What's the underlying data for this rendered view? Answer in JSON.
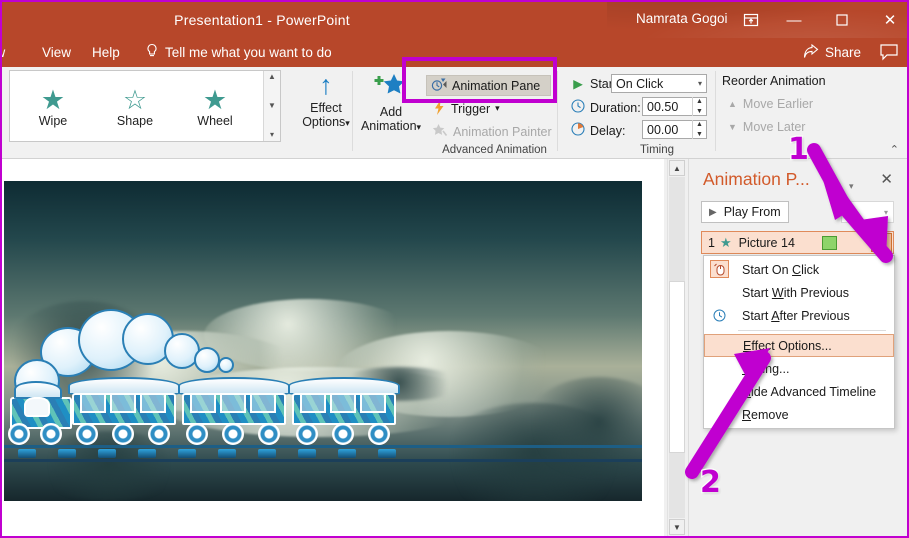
{
  "titlebar": {
    "document_title": "Presentation1  -  PowerPoint",
    "user_name": "Namrata Gogoi",
    "ribbon_display_icon": "ribbon-display-options-icon",
    "minimize": "—",
    "maximize": "☐",
    "close": "✕"
  },
  "tabs": {
    "review": "ew",
    "view": "View",
    "help": "Help",
    "tellme": "Tell me what you want to do",
    "tellme_icon": "lightbulb-icon",
    "share": "Share",
    "share_icon": "share-icon",
    "comment_icon": "comment-icon"
  },
  "ribbon": {
    "gallery": {
      "items": [
        {
          "label": "Wipe",
          "icon": "star-icon"
        },
        {
          "label": "Shape",
          "icon": "star-hollow-icon"
        },
        {
          "label": "Wheel",
          "icon": "star-icon"
        }
      ],
      "scroll_up": "▲",
      "scroll_down": "▼",
      "scroll_more": "▾"
    },
    "effect_options": {
      "label_line1": "Effect",
      "label_line2": "Options",
      "icon": "up-arrow-icon",
      "dropdown": "▾"
    },
    "dialog_launcher": "⤷",
    "add_animation": {
      "label_line1": "Add",
      "label_line2": "Animation",
      "icon": "add-animation-star-icon",
      "dropdown": "▾"
    },
    "advanced_animation": {
      "group_label": "Advanced Animation",
      "animation_pane": {
        "label": "Animation Pane",
        "icon": "animation-pane-icon",
        "active": true
      },
      "trigger": {
        "label": "Trigger",
        "icon": "trigger-bolt-icon",
        "dropdown": "▾"
      },
      "animation_painter": {
        "label": "Animation Painter",
        "icon": "animation-painter-icon",
        "disabled": true
      }
    },
    "timing": {
      "group_label": "Timing",
      "start_label": "Start:",
      "start_value": "On Click",
      "start_icon": "play-icon",
      "duration_label": "Duration:",
      "duration_value": "00.50",
      "duration_icon": "clock-icon",
      "delay_label": "Delay:",
      "delay_value": "00.00",
      "delay_icon": "delay-clock-icon",
      "spinner_up": "▲",
      "spinner_down": "▼",
      "combo_arrow": "▾"
    },
    "reorder": {
      "title": "Reorder Animation",
      "move_earlier": "Move Earlier",
      "move_later": "Move Later",
      "up_icon": "▲",
      "down_icon": "▼"
    },
    "collapse_icon": "⌃"
  },
  "slide": {
    "scroll_up": "▲",
    "scroll_down": "▼",
    "content_description": "cartoon blue train with three carriages and bubble smoke over a cloudy sky"
  },
  "animation_pane": {
    "title": "Animation P...",
    "menu_icon": "▾",
    "close_icon": "✕",
    "play_from": "Play From",
    "play_icon": "▶",
    "seek_arrow": "▾",
    "item": {
      "index": "1",
      "star_icon": "★",
      "name": "Picture 14",
      "timing_bar": "green-timing-bar",
      "dropdown_arrow": "▾"
    },
    "context_menu": [
      {
        "label_pre": "Start On ",
        "accel": "C",
        "label_post": "lick",
        "icon": "mouse-click-icon",
        "selected": false
      },
      {
        "label_pre": "Start ",
        "accel": "W",
        "label_post": "ith Previous",
        "icon": "",
        "selected": false
      },
      {
        "label_pre": "Start ",
        "accel": "A",
        "label_post": "fter Previous",
        "icon": "clock-icon",
        "selected": false
      },
      {
        "label_pre": "",
        "accel": "E",
        "label_post": "ffect Options...",
        "icon": "",
        "selected": true
      },
      {
        "label_pre": "",
        "accel": "T",
        "label_post": "iming...",
        "icon": "",
        "selected": false
      },
      {
        "label_pre": "",
        "accel": "H",
        "label_post": "ide Advanced Timeline",
        "icon": "",
        "selected": false
      },
      {
        "label_pre": "",
        "accel": "R",
        "label_post": "emove",
        "icon": "",
        "selected": false
      }
    ]
  },
  "annotations": {
    "step1": "1",
    "step2": "2",
    "highlight_color": "#c000d0"
  }
}
